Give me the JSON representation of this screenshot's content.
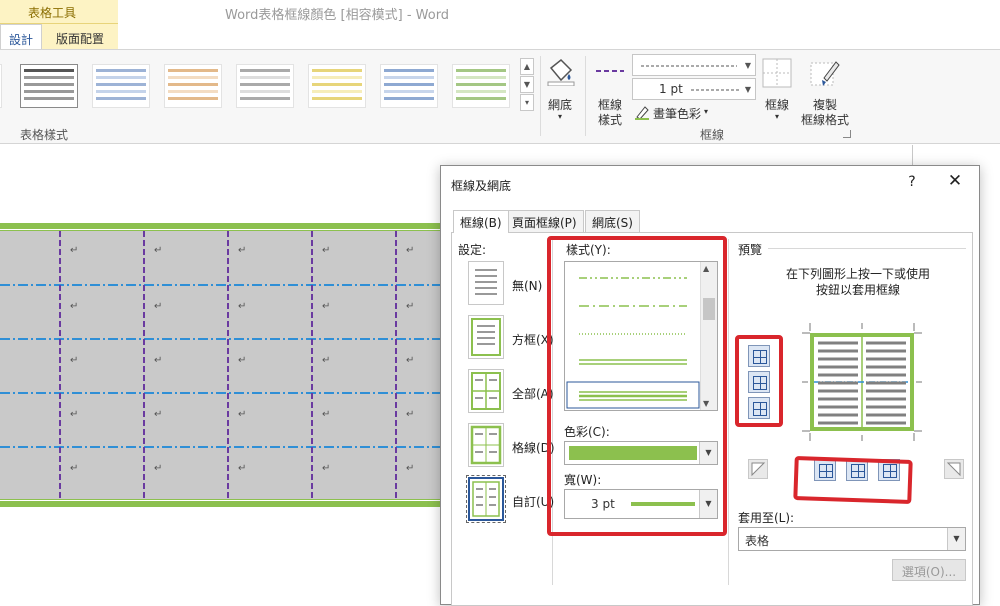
{
  "window": {
    "title": "Word表格框線顏色 [相容模式] - Word",
    "context_tab": "表格工具"
  },
  "ribbon": {
    "tabs": [
      "設計",
      "版面配置"
    ],
    "table_styles_label": "表格樣式",
    "shading_label": "網底",
    "border_style_label_1": "框線",
    "border_style_label_2": "樣式",
    "pen_weight": "1 pt",
    "pen_color_label": "畫筆色彩",
    "borders_label": "框線",
    "border_painter_1": "複製",
    "border_painter_2": "框線格式",
    "borders_group_label": "框線"
  },
  "document": {
    "cell_mark": "↵"
  },
  "dialog": {
    "title": "框線及網底",
    "help": "?",
    "close": "✕",
    "tabs": [
      "框線(B)",
      "頁面框線(P)",
      "網底(S)"
    ],
    "setting_label": "設定:",
    "settings": [
      {
        "label": "無(N)"
      },
      {
        "label": "方框(X)"
      },
      {
        "label": "全部(A)"
      },
      {
        "label": "格線(D)"
      },
      {
        "label": "自訂(U)"
      }
    ],
    "style_label": "樣式(Y):",
    "color_label": "色彩(C):",
    "width_label": "寬(W):",
    "width_value": "3 pt",
    "preview_label": "預覽",
    "preview_hint_1": "在下列圖形上按一下或使用",
    "preview_hint_2": "按鈕以套用框線",
    "apply_to_label": "套用至(L):",
    "apply_to_value": "表格",
    "options_button": "選項(O)..."
  },
  "colors": {
    "accent_green": "#8cc04e",
    "highlight_red": "#d9262c",
    "word_blue": "#2b579a",
    "cell_gray": "#c9c9c9",
    "dash_blue": "#2f8fd6",
    "dash_purple": "#6a3aa0"
  }
}
